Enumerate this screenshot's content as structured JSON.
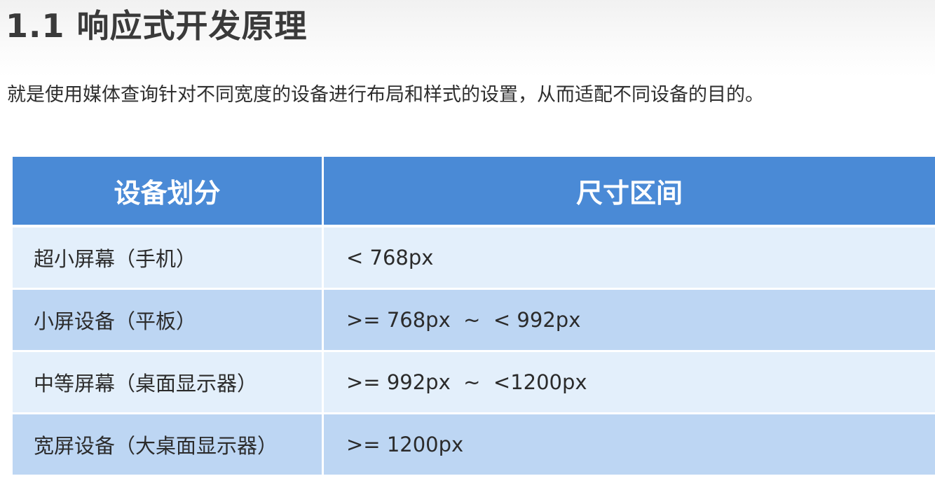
{
  "page": {
    "title": "1.1 响应式开发原理",
    "intro": "就是使用媒体查询针对不同宽度的设备进行布局和样式的设置，从而适配不同设备的目的。"
  },
  "table": {
    "headers": [
      "设备划分",
      "尺寸区间"
    ],
    "rows": [
      {
        "device": "超小屏幕（手机）",
        "range": "< 768px"
      },
      {
        "device": "小屏设备（平板）",
        "range": ">= 768px  ~  < 992px"
      },
      {
        "device": "中等屏幕（桌面显示器）",
        "range": ">= 992px  ~  <1200px"
      },
      {
        "device": "宽屏设备（大桌面显示器）",
        "range": ">= 1200px"
      }
    ]
  },
  "colors": {
    "header_bg": "#4a8ad6",
    "row_light": "#e3effb",
    "row_dark": "#bdd6f3",
    "title_text": "#3a3a3a"
  }
}
